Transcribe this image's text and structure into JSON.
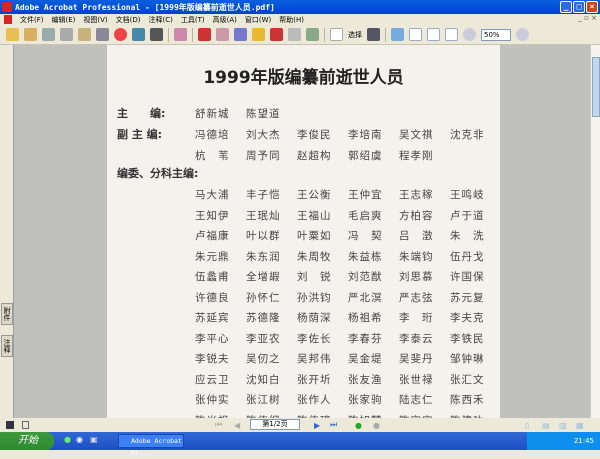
{
  "window": {
    "title": "Adobe Acrobat Professional - [1999年版编纂前逝世人员.pdf]"
  },
  "menu": [
    "文件(F)",
    "编辑(E)",
    "视图(V)",
    "文档(D)",
    "注释(C)",
    "工具(T)",
    "高级(A)",
    "窗口(W)",
    "帮助(H)"
  ],
  "toolbar": {
    "select_label": "选择",
    "zoom_value": "50%"
  },
  "left_tabs": [
    "附件",
    "注释"
  ],
  "document": {
    "title": "1999年版编纂前逝世人员",
    "chief_label": "主　　编:",
    "chief": [
      "舒新城",
      "陈望道"
    ],
    "deputy_label": "副 主 编:",
    "deputy": [
      [
        "冯德培",
        "刘大杰",
        "李俊民",
        "李培南",
        "吴文祺",
        "沈克非"
      ],
      [
        "杭　苇",
        "周予同",
        "赵超构",
        "郭绍虞",
        "程孝刚"
      ]
    ],
    "committee_label": "编委、分科主编:",
    "committee": [
      [
        "马大浦",
        "丰子恺",
        "王公衡",
        "王仲宜",
        "王志稼",
        "王鸣岐"
      ],
      [
        "王知伊",
        "王珉灿",
        "王福山",
        "毛启爽",
        "方柏容",
        "卢于道"
      ],
      [
        "卢福康",
        "叶以群",
        "叶粟如",
        "冯　契",
        "吕　澂",
        "朱　洗"
      ],
      [
        "朱元鼎",
        "朱东润",
        "朱周牧",
        "朱益栋",
        "朱端钧",
        "伍丹戈"
      ],
      [
        "伍蠡甫",
        "全增嘏",
        "刘　锐",
        "刘范猷",
        "刘思慕",
        "许国保"
      ],
      [
        "许德良",
        "孙怀仁",
        "孙洪钧",
        "严北溟",
        "严志弦",
        "苏元复"
      ],
      [
        "苏延宾",
        "苏德隆",
        "杨荫深",
        "杨祖希",
        "李　珩",
        "李夫克"
      ],
      [
        "李平心",
        "李亚农",
        "李佐长",
        "李春芬",
        "李泰云",
        "李铁民"
      ],
      [
        "李锐夫",
        "吴仞之",
        "吴邦伟",
        "吴金堤",
        "吴斐丹",
        "邹钟琳"
      ],
      [
        "应云卫",
        "沈知白",
        "张开圻",
        "张友渔",
        "张世禄",
        "张汇文"
      ],
      [
        "张仲实",
        "张江树",
        "张作人",
        "张家驹",
        "陆志仁",
        "陈西禾"
      ],
      [
        "陈光祖",
        "陈传纲",
        "陈传璋",
        "陈旭麓",
        "陈守实",
        "陈建功"
      ]
    ]
  },
  "nav": {
    "page": "第1/2页"
  },
  "taskbar": {
    "start": "开始",
    "task": "Adobe Acrobat Pr...",
    "clock": "21:45"
  }
}
